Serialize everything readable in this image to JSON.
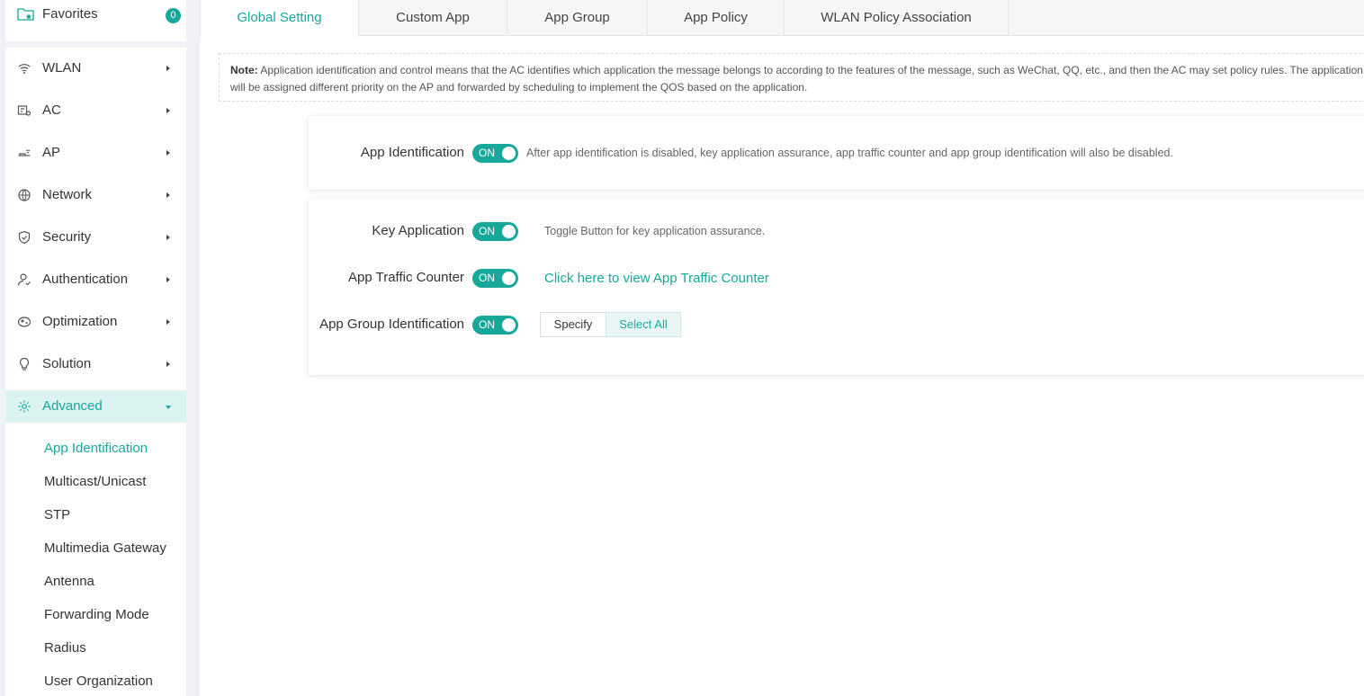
{
  "sidebar": {
    "favorites": {
      "label": "Favorites",
      "count": "0"
    },
    "items": [
      {
        "label": "WLAN",
        "icon": "wifi-icon"
      },
      {
        "label": "AC",
        "icon": "ac-icon"
      },
      {
        "label": "AP",
        "icon": "ap-icon"
      },
      {
        "label": "Network",
        "icon": "network-icon"
      },
      {
        "label": "Security",
        "icon": "shield-icon"
      },
      {
        "label": "Authentication",
        "icon": "user-icon"
      },
      {
        "label": "Optimization",
        "icon": "optimization-icon"
      },
      {
        "label": "Solution",
        "icon": "lightbulb-icon"
      },
      {
        "label": "Advanced",
        "icon": "gear-icon"
      }
    ],
    "advanced_sub": [
      "App Identification",
      "Multicast/Unicast",
      "STP",
      "Multimedia Gateway",
      "Antenna",
      "Forwarding Mode",
      "Radius",
      "User Organization"
    ]
  },
  "tabs": [
    "Global Setting",
    "Custom App",
    "App Group",
    "App Policy",
    "WLAN Policy Association"
  ],
  "note": {
    "prefix": "Note:",
    "text": "Application identification and control means that the AC identifies which application the message belongs to according to the features of the message, such as WeChat, QQ, etc., and then the AC may set policy rules. The application will be assigned different priority on the AP and forwarded by scheduling to implement the QOS based on the application."
  },
  "settings": {
    "app_identification": {
      "label": "App Identification",
      "state": "ON",
      "hint": "After app identification is disabled, key application assurance, app traffic counter and app group identification will also be disabled."
    },
    "key_application": {
      "label": "Key Application",
      "state": "ON",
      "hint": "Toggle Button for key application assurance."
    },
    "app_traffic_counter": {
      "label": "App Traffic Counter",
      "state": "ON",
      "link": "Click here to view App Traffic Counter"
    },
    "app_group_identification": {
      "label": "App Group Identification",
      "state": "ON",
      "options": [
        "Specify",
        "Select All"
      ],
      "selected": "Select All"
    }
  },
  "colors": {
    "accent": "#18a89b",
    "active_bg": "#dbf3f1"
  }
}
